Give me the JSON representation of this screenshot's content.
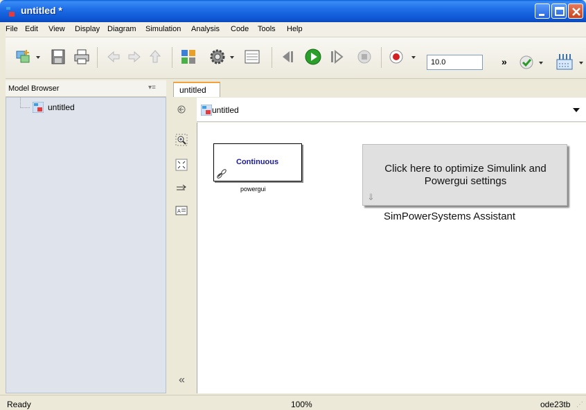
{
  "window": {
    "title": "untitled *",
    "buttons": {
      "minimize": "minimize-icon",
      "maximize": "maximize-icon",
      "close": "close-icon"
    }
  },
  "menu": {
    "items": [
      "File",
      "Edit",
      "View",
      "Display",
      "Diagram",
      "Simulation",
      "Analysis",
      "Code",
      "Tools",
      "Help"
    ]
  },
  "toolbar": {
    "stop_time": "10.0",
    "more_label": "»"
  },
  "model_browser": {
    "title": "Model Browser",
    "menu_glyph": "▾≡",
    "tree": [
      {
        "label": "untitled"
      }
    ]
  },
  "tabs": [
    {
      "label": "untitled"
    }
  ],
  "address": {
    "path": "untitled"
  },
  "palette": {
    "collapse_label": "«"
  },
  "canvas": {
    "powergui": {
      "block_text": "Continuous",
      "label": "powergui"
    },
    "assistant": {
      "text": "Click here to optimize Simulink and Powergui settings",
      "label": "SimPowerSystems Assistant"
    }
  },
  "status": {
    "ready": "Ready",
    "zoom": "100%",
    "solver": "ode23tb"
  },
  "colors": {
    "title_bar": "#1f6ee8",
    "tab_accent": "#f3a13a",
    "run_green": "#2aa02a",
    "record_red": "#d32020",
    "block_text": "#1a1a9a"
  }
}
